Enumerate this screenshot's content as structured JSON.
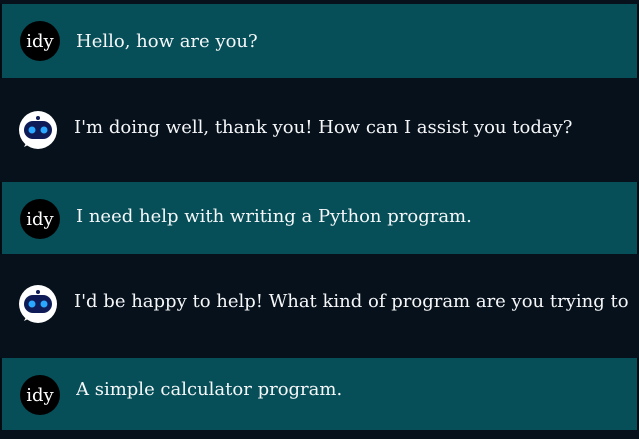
{
  "messages": [
    {
      "role": "user",
      "avatar_label": "idy",
      "text": "Hello, how are you?"
    },
    {
      "role": "assistant",
      "avatar_icon": "robot-icon",
      "text": "I'm doing well, thank you! How can I assist you today?"
    },
    {
      "role": "user",
      "avatar_label": "idy",
      "text": "I need help with writing a Python program."
    },
    {
      "role": "assistant",
      "avatar_icon": "robot-icon",
      "text": "I'd be happy to help! What kind of program are you trying to write?"
    },
    {
      "role": "user",
      "avatar_label": "idy",
      "text": "A simple calculator program."
    }
  ],
  "colors": {
    "user_row": "#064f58",
    "bot_row": "#07111b",
    "text": "#f5f7f9",
    "user_avatar": "#000000",
    "bot_avatar_face": "#0e1b56",
    "bot_avatar_eyes": "#2aa8ff"
  }
}
